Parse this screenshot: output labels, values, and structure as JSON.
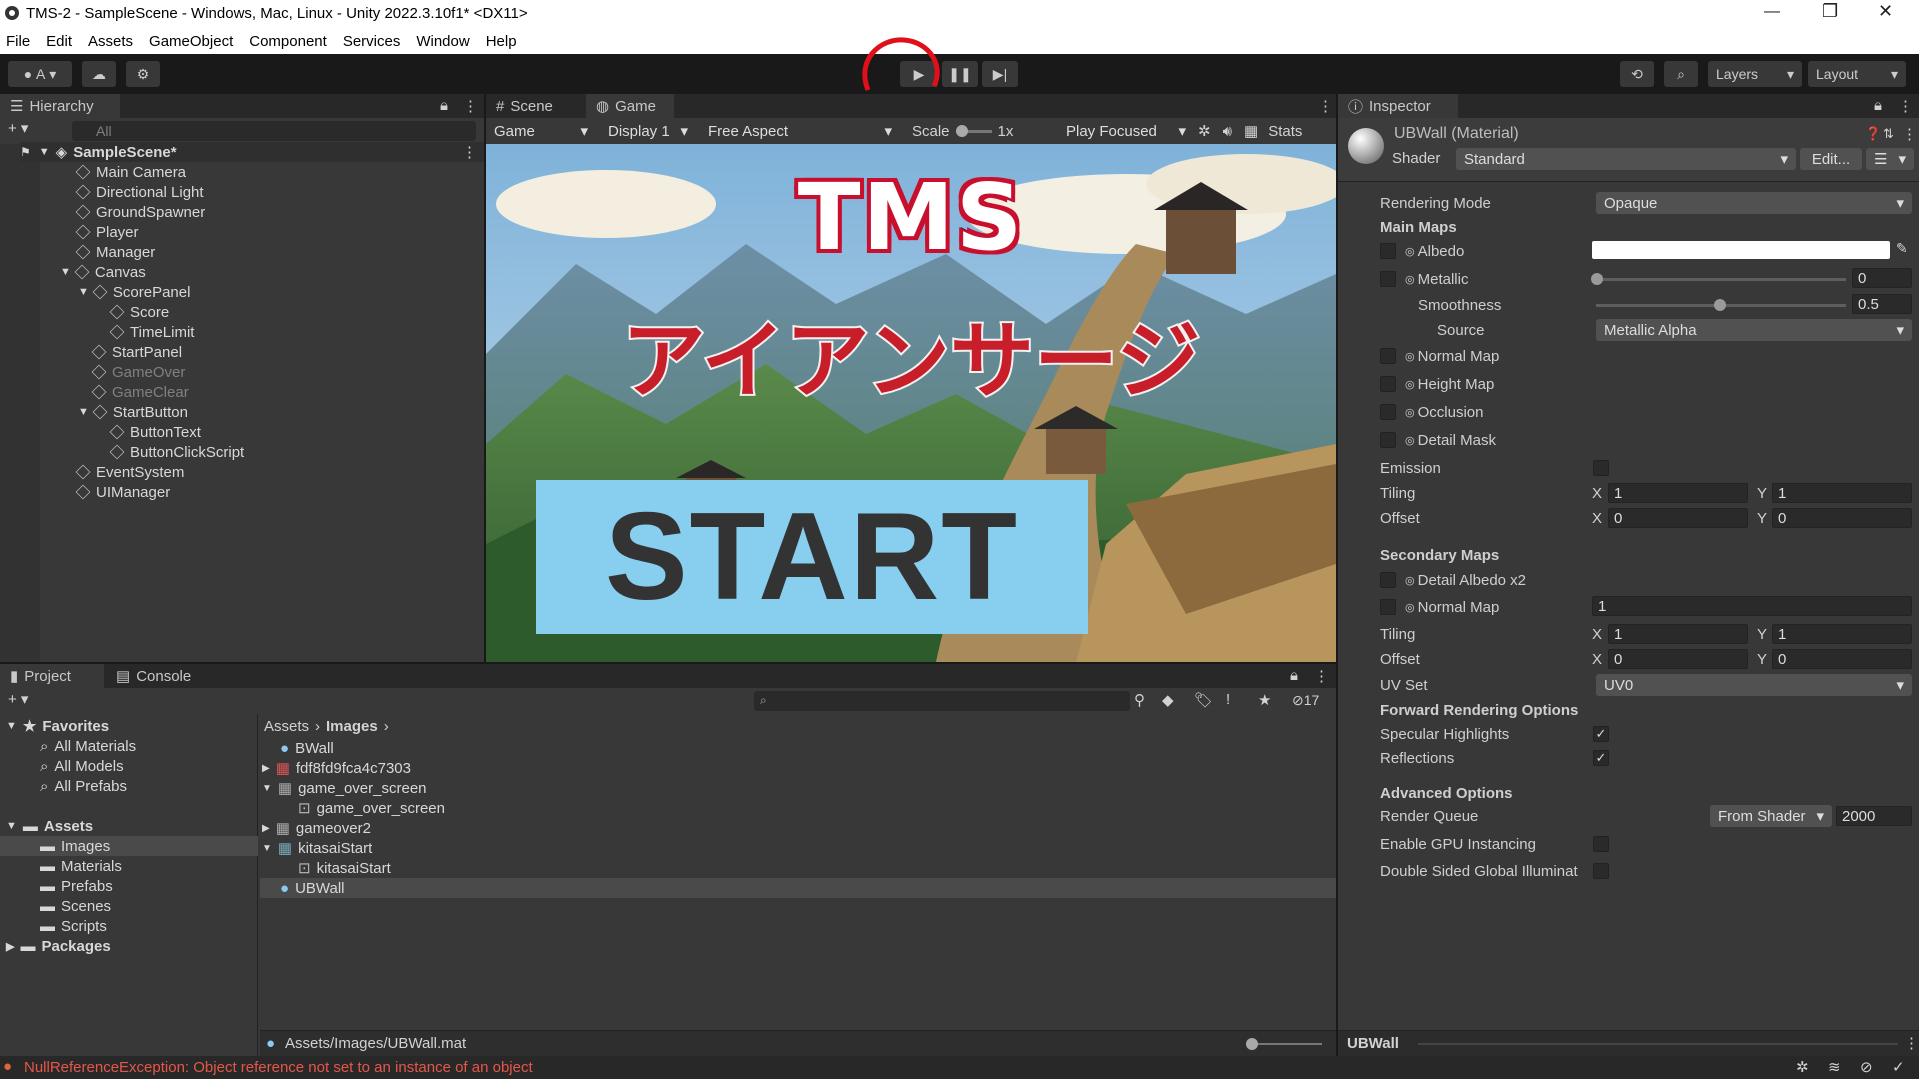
{
  "window": {
    "title": "TMS-2 - SampleScene - Windows, Mac, Linux - Unity 2022.3.10f1* <DX11>"
  },
  "menu": [
    "File",
    "Edit",
    "Assets",
    "GameObject",
    "Component",
    "Services",
    "Window",
    "Help"
  ],
  "toolbar": {
    "account": "A",
    "layers": "Layers",
    "layout": "Layout"
  },
  "hierarchy": {
    "tab": "Hierarchy",
    "search_placeholder": "All",
    "scene": "SampleScene*",
    "items": [
      "Main Camera",
      "Directional Light",
      "GroundSpawner",
      "Player",
      "Manager",
      "Canvas",
      "ScorePanel",
      "Score",
      "TimeLimit",
      "StartPanel",
      "GameOver",
      "GameClear",
      "StartButton",
      "ButtonText",
      "ButtonClickScript",
      "EventSystem",
      "UIManager"
    ]
  },
  "view": {
    "tabs": [
      "Scene",
      "Game"
    ],
    "game_dd": "Game",
    "display": "Display 1",
    "aspect": "Free Aspect",
    "scale_label": "Scale",
    "scale_value": "1x",
    "play_focused": "Play Focused",
    "stats": "Stats",
    "title_en": "TMS",
    "title_jp": "アイアンサージ",
    "start": "START"
  },
  "project": {
    "tabs": [
      "Project",
      "Console"
    ],
    "favorites": "Favorites",
    "fav_items": [
      "All Materials",
      "All Models",
      "All Prefabs"
    ],
    "assets": "Assets",
    "asset_folders": [
      "Images",
      "Materials",
      "Prefabs",
      "Scenes",
      "Scripts"
    ],
    "packages": "Packages",
    "breadcrumb": [
      "Assets",
      "Images"
    ],
    "files": [
      "BWall",
      "fdf8fd9fca4c7303",
      "game_over_screen",
      "game_over_screen",
      "gameover2",
      "kitasaiStart",
      "kitasaiStart",
      "UBWall"
    ],
    "hidden_count": "17",
    "path": "Assets/Images/UBWall.mat"
  },
  "inspector": {
    "tab": "Inspector",
    "name": "UBWall (Material)",
    "shader_label": "Shader",
    "shader": "Standard",
    "edit": "Edit...",
    "rendering_mode_label": "Rendering Mode",
    "rendering_mode": "Opaque",
    "main_maps": "Main Maps",
    "albedo": "Albedo",
    "metallic": "Metallic",
    "metallic_val": "0",
    "smoothness": "Smoothness",
    "smoothness_val": "0.5",
    "source": "Source",
    "source_val": "Metallic Alpha",
    "normal_map": "Normal Map",
    "height_map": "Height Map",
    "occlusion": "Occlusion",
    "detail_mask": "Detail Mask",
    "emission": "Emission",
    "tiling": "Tiling",
    "offset": "Offset",
    "x": "X",
    "y": "Y",
    "one": "1",
    "zero": "0",
    "secondary_maps": "Secondary Maps",
    "detail_albedo": "Detail Albedo x2",
    "normal_map2": "Normal Map",
    "normal_val": "1",
    "uv_set": "UV Set",
    "uv_val": "UV0",
    "forward": "Forward Rendering Options",
    "specular": "Specular Highlights",
    "reflections": "Reflections",
    "advanced": "Advanced Options",
    "render_queue": "Render Queue",
    "from_shader": "From Shader",
    "queue_val": "2000",
    "gpu": "Enable GPU Instancing",
    "double_sided": "Double Sided Global Illuminat",
    "footer": "UBWall"
  },
  "status": {
    "error": "NullReferenceException: Object reference not set to an instance of an object"
  }
}
